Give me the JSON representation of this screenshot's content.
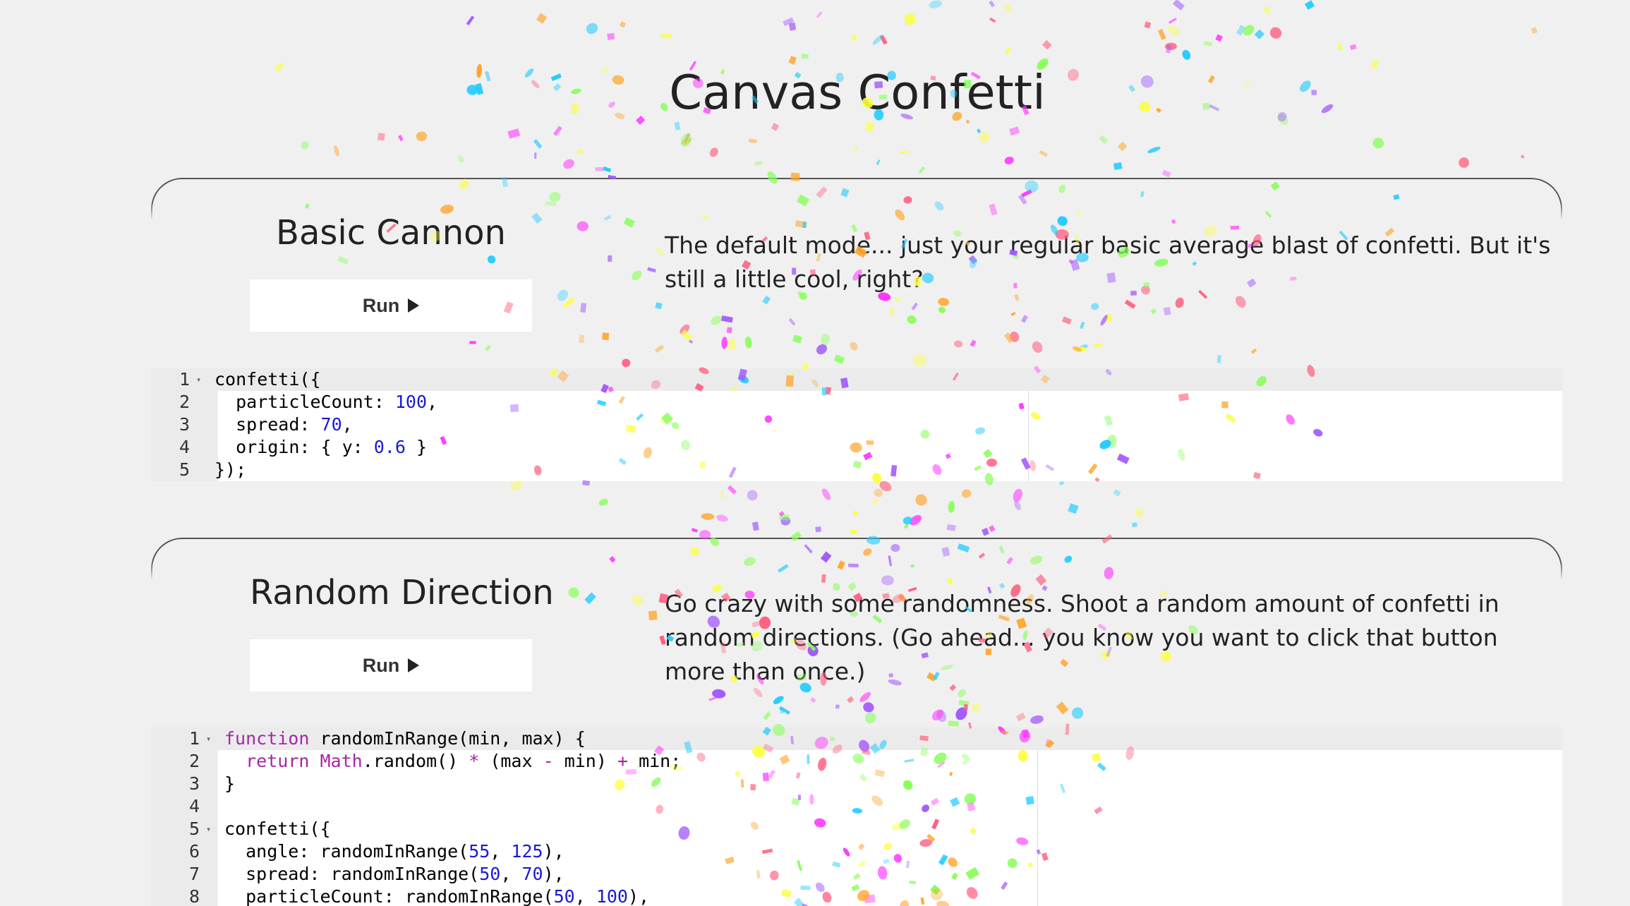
{
  "page": {
    "title": "Canvas Confetti"
  },
  "sections": [
    {
      "heading": "Basic Cannon",
      "run_label": "Run",
      "description": "The default mode... just your regular basic average blast of confetti. But it's still a little cool, right?",
      "code_lines": [
        {
          "n": "1",
          "fold": true,
          "tokens": [
            {
              "t": "confetti({",
              "c": ""
            }
          ]
        },
        {
          "n": "2",
          "fold": false,
          "tokens": [
            {
              "t": "  particleCount: ",
              "c": ""
            },
            {
              "t": "100",
              "c": "num"
            },
            {
              "t": ",",
              "c": ""
            }
          ]
        },
        {
          "n": "3",
          "fold": false,
          "tokens": [
            {
              "t": "  spread: ",
              "c": ""
            },
            {
              "t": "70",
              "c": "num"
            },
            {
              "t": ",",
              "c": ""
            }
          ]
        },
        {
          "n": "4",
          "fold": false,
          "tokens": [
            {
              "t": "  origin: { y: ",
              "c": ""
            },
            {
              "t": "0.6",
              "c": "num"
            },
            {
              "t": " }",
              "c": ""
            }
          ]
        },
        {
          "n": "5",
          "fold": false,
          "tokens": [
            {
              "t": "});",
              "c": ""
            }
          ]
        }
      ]
    },
    {
      "heading": "Random Direction",
      "run_label": "Run",
      "description": "Go crazy with some randomness. Shoot a random amount of confetti in random directions. (Go ahead... you know you want to click that button more than once.)",
      "code_lines": [
        {
          "n": "1",
          "fold": true,
          "tokens": [
            {
              "t": "function",
              "c": "kw"
            },
            {
              "t": " randomInRange(min, max) {",
              "c": ""
            }
          ]
        },
        {
          "n": "2",
          "fold": false,
          "tokens": [
            {
              "t": "  ",
              "c": ""
            },
            {
              "t": "return",
              "c": "kw"
            },
            {
              "t": " ",
              "c": ""
            },
            {
              "t": "Math",
              "c": "cls"
            },
            {
              "t": ".random() ",
              "c": ""
            },
            {
              "t": "*",
              "c": "op"
            },
            {
              "t": " (max ",
              "c": ""
            },
            {
              "t": "-",
              "c": "op"
            },
            {
              "t": " min) ",
              "c": ""
            },
            {
              "t": "+",
              "c": "op"
            },
            {
              "t": " min;",
              "c": ""
            }
          ]
        },
        {
          "n": "3",
          "fold": false,
          "tokens": [
            {
              "t": "}",
              "c": ""
            }
          ]
        },
        {
          "n": "4",
          "fold": false,
          "tokens": [
            {
              "t": "",
              "c": ""
            }
          ]
        },
        {
          "n": "5",
          "fold": true,
          "tokens": [
            {
              "t": "confetti({",
              "c": ""
            }
          ]
        },
        {
          "n": "6",
          "fold": false,
          "tokens": [
            {
              "t": "  angle: randomInRange(",
              "c": ""
            },
            {
              "t": "55",
              "c": "num"
            },
            {
              "t": ", ",
              "c": ""
            },
            {
              "t": "125",
              "c": "num"
            },
            {
              "t": "),",
              "c": ""
            }
          ]
        },
        {
          "n": "7",
          "fold": false,
          "tokens": [
            {
              "t": "  spread: randomInRange(",
              "c": ""
            },
            {
              "t": "50",
              "c": "num"
            },
            {
              "t": ", ",
              "c": ""
            },
            {
              "t": "70",
              "c": "num"
            },
            {
              "t": "),",
              "c": ""
            }
          ]
        },
        {
          "n": "8",
          "fold": false,
          "tokens": [
            {
              "t": "  particleCount: randomInRange(",
              "c": ""
            },
            {
              "t": "50",
              "c": "num"
            },
            {
              "t": ", ",
              "c": ""
            },
            {
              "t": "100",
              "c": "num"
            },
            {
              "t": "),",
              "c": ""
            }
          ]
        }
      ]
    }
  ],
  "colors": {
    "background": "#f0f0f0",
    "confetti": [
      "#26ccff",
      "#a25afd",
      "#ff5e7e",
      "#88ff5a",
      "#fcff42",
      "#ffa62d",
      "#ff36ff"
    ]
  }
}
